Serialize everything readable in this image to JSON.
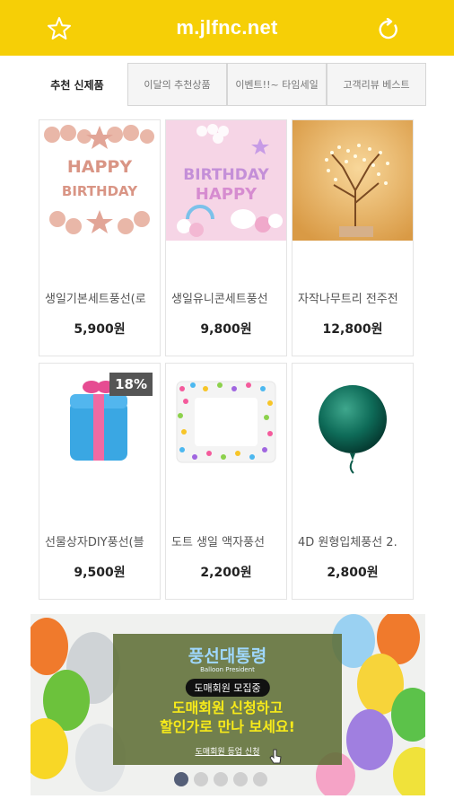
{
  "header": {
    "title": "m.jlfnc.net",
    "left_icon": "star-icon",
    "right_icon": "refresh-icon",
    "bar_color": "#f6cf06"
  },
  "tabs": [
    {
      "label": "추천 신제품",
      "active": true
    },
    {
      "label": "이달의 추천상품",
      "active": false
    },
    {
      "label": "이벤트!!~ 타임세일",
      "active": false
    },
    {
      "label": "고객리뷰 베스트",
      "active": false
    }
  ],
  "products": [
    {
      "name": "생일기본세트풍선(로",
      "price": "5,900원",
      "image": "happy-birthday-rose-gold-balloons"
    },
    {
      "name": "생일유니콘세트풍선",
      "price": "9,800원",
      "image": "birthday-happy-pink-unicorn-balloons"
    },
    {
      "name": "자작나무트리 전주전",
      "price": "12,800원",
      "image": "birch-tree-light"
    },
    {
      "name": "선물상자DIY풍선(블",
      "price": "9,500원",
      "badge": "18%",
      "image": "gift-box-balloon"
    },
    {
      "name": "도트 생일 액자풍선",
      "price": "2,200원",
      "image": "dot-frame-balloon"
    },
    {
      "name": "4D 원형입체풍선 2.",
      "price": "2,800원",
      "image": "green-4d-balloon"
    }
  ],
  "banner": {
    "brand": "풍선대통령",
    "brand_sub": "Balloon President",
    "recruit": "도매회원 모집중",
    "headline_1": "도매회원 신청하고",
    "headline_2": "할인가로 만나 보세요!",
    "link": "도매회원 등업 신청",
    "dots": 5,
    "active_dot": 0
  }
}
